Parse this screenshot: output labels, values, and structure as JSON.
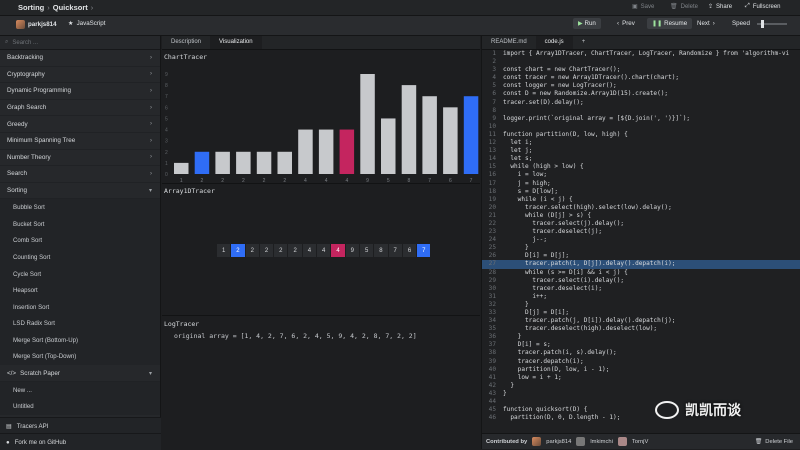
{
  "breadcrumb": {
    "category": "Sorting",
    "algorithm": "Quicksort"
  },
  "top_actions": {
    "save": "Save",
    "delete": "Delete",
    "share": "Share",
    "fullscreen": "Fullscreen"
  },
  "toolbar": {
    "user": "parkjs814",
    "language": "JavaScript",
    "run": "Run",
    "prev": "Prev",
    "resume": "Resume",
    "next": "Next",
    "speed": "Speed"
  },
  "sidebar": {
    "search_placeholder": "Search ...",
    "categories": [
      "Backtracking",
      "Cryptography",
      "Dynamic Programming",
      "Graph Search",
      "Greedy",
      "Minimum Spanning Tree",
      "Number Theory",
      "Search",
      "Sorting"
    ],
    "sorting_items": [
      "Bubble Sort",
      "Bucket Sort",
      "Comb Sort",
      "Counting Sort",
      "Cycle Sort",
      "Heapsort",
      "Insertion Sort",
      "LSD Radix Sort",
      "Merge Sort (Bottom-Up)",
      "Merge Sort (Top-Down)"
    ],
    "scratch": "Scratch Paper",
    "scratch_items": [
      "New ...",
      "Untitled"
    ],
    "tracers_api": "Tracers API",
    "github": "Fork me on GitHub"
  },
  "center": {
    "tabs": [
      "Description",
      "Visualization"
    ],
    "chart_title": "ChartTracer",
    "array_title": "Array1DTracer",
    "log_title": "LogTracer",
    "log_line": "original array = [1, 4, 2, 7, 6, 2, 4, 5, 9, 4, 2, 8, 7, 2, 2]"
  },
  "chart_tracer": {
    "values": [
      1,
      2,
      2,
      2,
      2,
      2,
      4,
      4,
      4,
      9,
      5,
      8,
      7,
      6,
      7
    ],
    "highlight": {
      "1": "#2f6df6",
      "8": "#c4255f",
      "14": "#2f6df6"
    },
    "ymax": 9
  },
  "array_tracer": {
    "values": [
      1,
      2,
      2,
      2,
      2,
      2,
      4,
      4,
      4,
      9,
      5,
      8,
      7,
      6,
      7
    ],
    "highlight": {
      "1": "#2f6df6",
      "8": "#c4255f",
      "14": "#2f6df6"
    }
  },
  "right": {
    "tabs": [
      "README.md",
      "code.js",
      "+"
    ],
    "contributed_by": "Contributed by",
    "contributors": [
      "parkjs814",
      "lmkimchi",
      "TornjV"
    ],
    "delete_file": "Delete File"
  },
  "code": [
    "import { Array1DTracer, ChartTracer, LogTracer, Randomize } from 'algorithm-vi",
    "",
    "const chart = new ChartTracer();",
    "const tracer = new Array1DTracer().chart(chart);",
    "const logger = new LogTracer();",
    "const D = new Randomize.Array1D(15).create();",
    "tracer.set(D).delay();",
    "",
    "logger.print(`original array = [${D.join(', ')}]`);",
    "",
    "function partition(D, low, high) {",
    "  let i;",
    "  let j;",
    "  let s;",
    "  while (high > low) {",
    "    i = low;",
    "    j = high;",
    "    s = D[low];",
    "    while (i < j) {",
    "      tracer.select(high).select(low).delay();",
    "      while (D[j] > s) {",
    "        tracer.select(j).delay();",
    "        tracer.deselect(j);",
    "        j--;",
    "      }",
    "      D[i] = D[j];",
    "      tracer.patch(i, D[j]).delay().depatch(i);",
    "      while (s >= D[i] && i < j) {",
    "        tracer.select(i).delay();",
    "        tracer.deselect(i);",
    "        i++;",
    "      }",
    "      D[j] = D[i];",
    "      tracer.patch(j, D[i]).delay().depatch(j);",
    "      tracer.deselect(high).deselect(low);",
    "    }",
    "    D[i] = s;",
    "    tracer.patch(i, s).delay();",
    "    tracer.depatch(i);",
    "    partition(D, low, i - 1);",
    "    low = i + 1;",
    "  }",
    "}",
    "",
    "function quicksort(D) {",
    "  partition(D, 0, D.length - 1);"
  ],
  "code_highlight_line": 27,
  "watermark": "凯凯而谈"
}
